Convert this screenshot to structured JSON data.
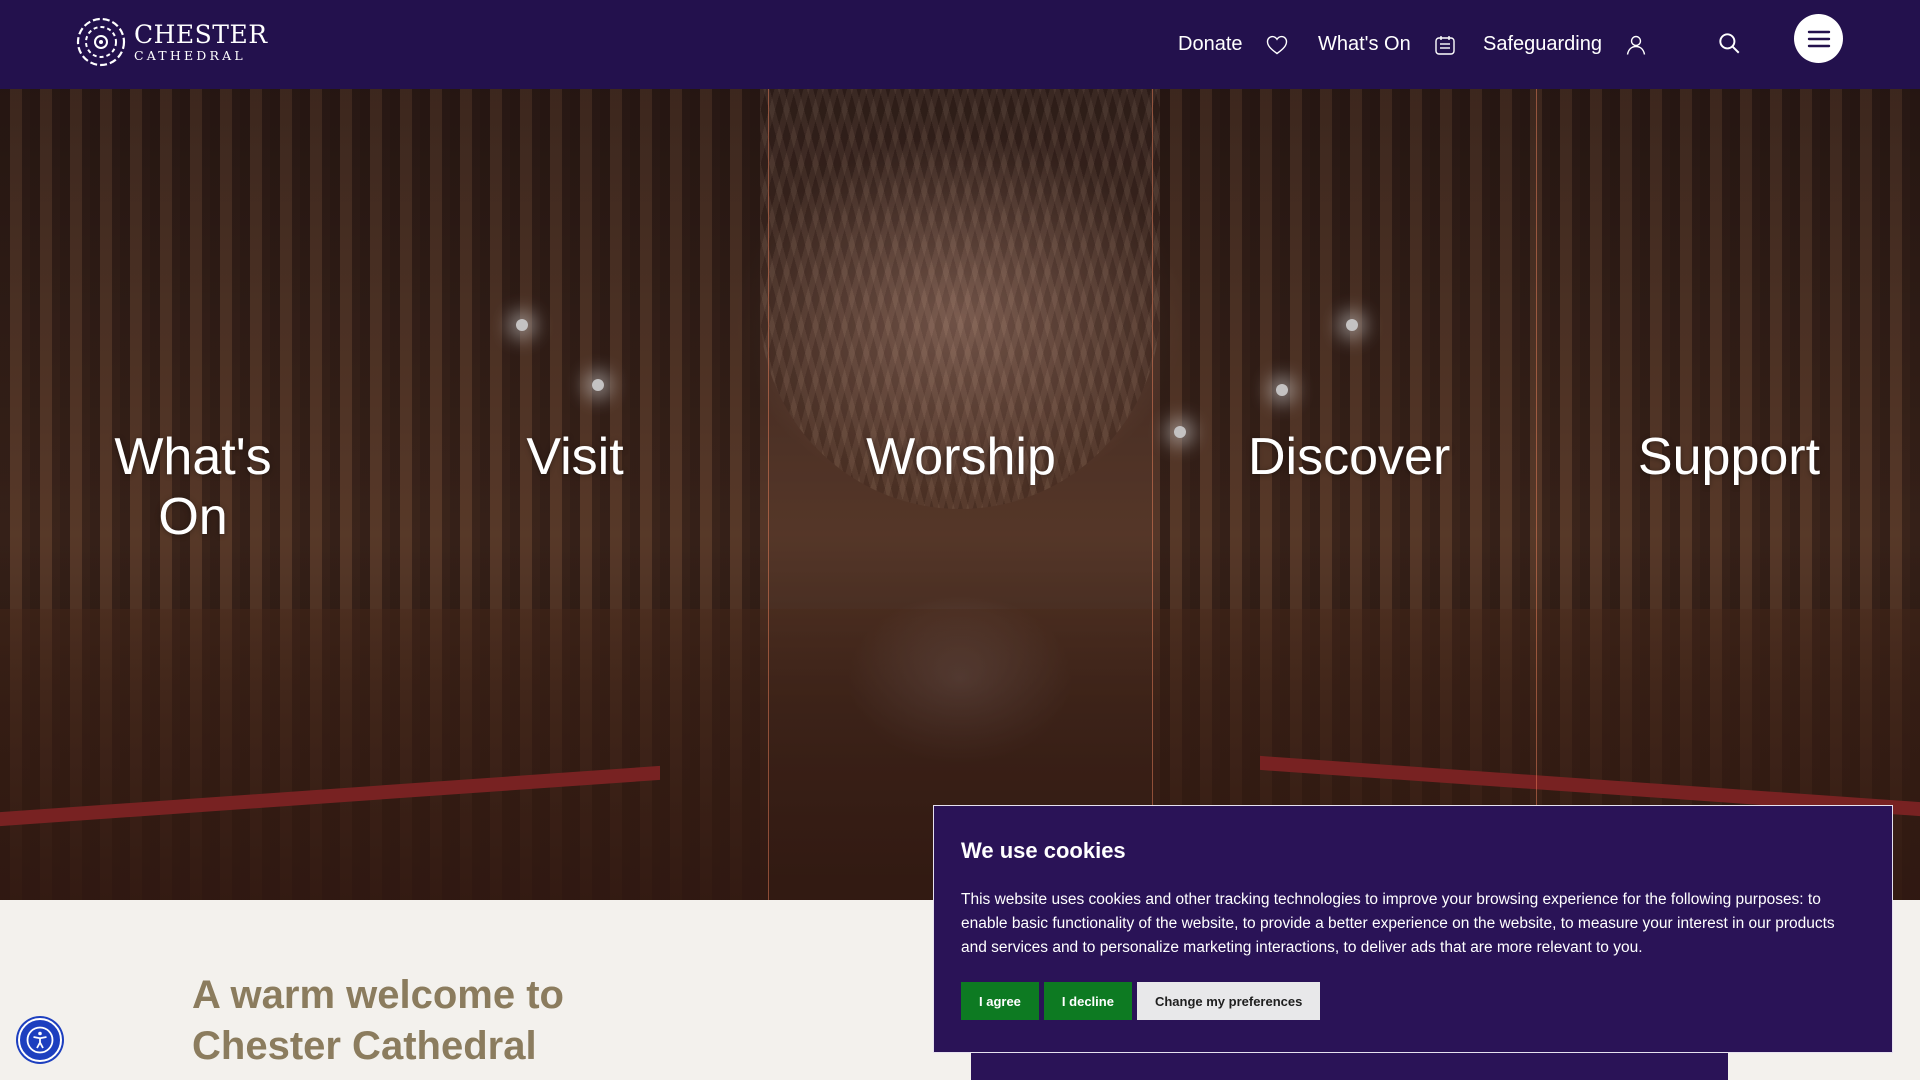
{
  "header": {
    "logo": {
      "line1": "CHESTER",
      "line2": "CATHEDRAL"
    },
    "nav": [
      {
        "label": "Donate",
        "icon": "heart-icon"
      },
      {
        "label": "What's On",
        "icon": "calendar-icon"
      },
      {
        "label": "Safeguarding",
        "icon": "user-icon"
      }
    ],
    "search_icon": "search-icon",
    "menu_icon": "hamburger-menu-icon"
  },
  "hero": {
    "sections": [
      "What's On",
      "Visit",
      "Worship",
      "Discover",
      "Support"
    ]
  },
  "welcome": {
    "line1": "A warm welcome to",
    "line2": "Chester Cathedral"
  },
  "cookie_banner": {
    "title": "We use cookies",
    "text": "This website uses cookies and other tracking technologies to improve your browsing experience for the following purposes: to enable basic functionality of the website, to provide a better experience on the website, to measure your interest in our products and services and to personalize marketing interactions, to deliver ads that are more relevant to you.",
    "agree_label": "I agree",
    "decline_label": "I decline",
    "preferences_label": "Change my preferences"
  },
  "colors": {
    "header_bg": "#23114d",
    "cookie_bg": "#2a1357",
    "button_green": "#0d7a22",
    "welcome_text": "#8b7c5e",
    "accessibility_blue": "#1d3fbf"
  },
  "accessibility_icon": "accessibility-icon"
}
